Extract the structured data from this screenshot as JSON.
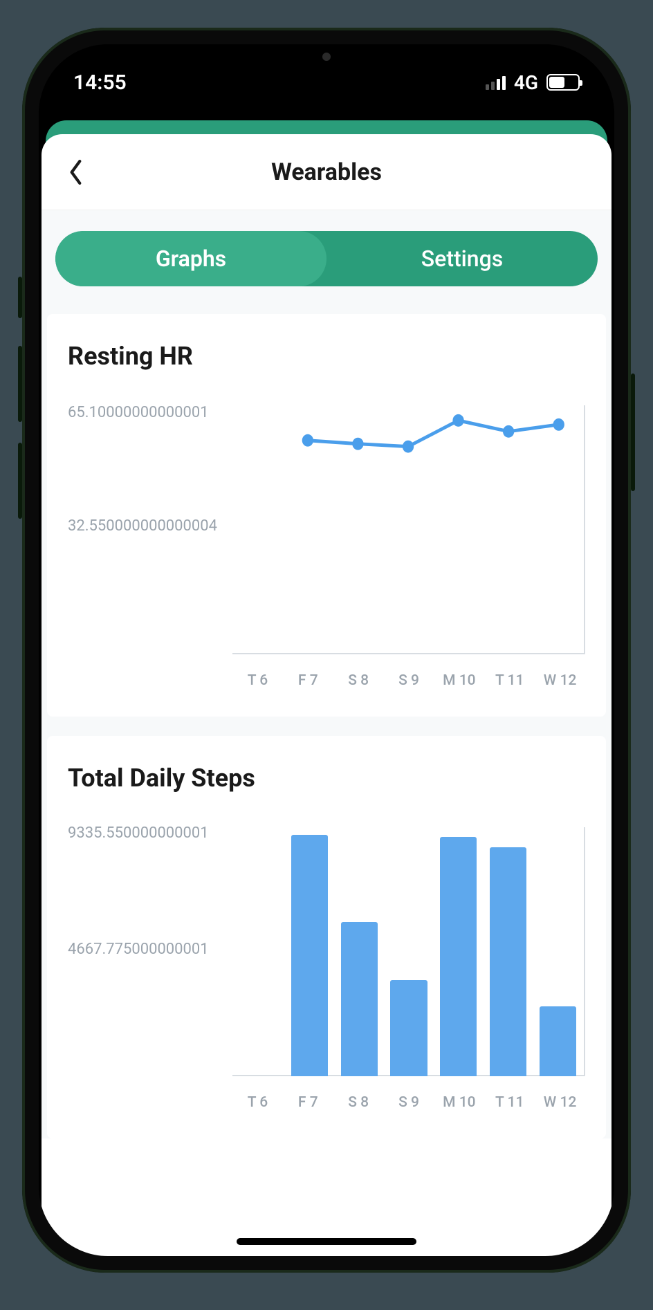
{
  "status": {
    "time": "14:55",
    "network": "4G"
  },
  "header": {
    "title": "Wearables"
  },
  "tabs": {
    "graphs": "Graphs",
    "settings": "Settings",
    "active": "graphs"
  },
  "hr": {
    "title": "Resting HR",
    "y_ticks": [
      "65.10000000000001",
      "32.550000000000004"
    ],
    "x_ticks": [
      "T 6",
      "F 7",
      "S 8",
      "S 9",
      "M 10",
      "T 11",
      "W 12"
    ]
  },
  "steps": {
    "title": "Total Daily Steps",
    "y_ticks": [
      "9335.550000000001",
      "4667.775000000001"
    ],
    "x_ticks": [
      "T 6",
      "F 7",
      "S 8",
      "S 9",
      "M 10",
      "T 11",
      "W 12"
    ]
  },
  "chart_data": [
    {
      "type": "line",
      "title": "Resting HR",
      "categories": [
        "T 6",
        "F 7",
        "S 8",
        "S 9",
        "M 10",
        "T 11",
        "W 12"
      ],
      "values": [
        null,
        58,
        57,
        56,
        63,
        60,
        62
      ],
      "ylim": [
        0,
        65.10000000000001
      ],
      "y_ticks": [
        65.10000000000001,
        32.550000000000004
      ],
      "xlabel": "",
      "ylabel": ""
    },
    {
      "type": "bar",
      "title": "Total Daily Steps",
      "categories": [
        "T 6",
        "F 7",
        "S 8",
        "S 9",
        "M 10",
        "T 11",
        "W 12"
      ],
      "values": [
        0,
        9100,
        5800,
        3600,
        9000,
        8600,
        2600
      ],
      "ylim": [
        0,
        9335.550000000001
      ],
      "y_ticks": [
        9335.550000000001,
        4667.775000000001
      ],
      "xlabel": "",
      "ylabel": ""
    }
  ]
}
